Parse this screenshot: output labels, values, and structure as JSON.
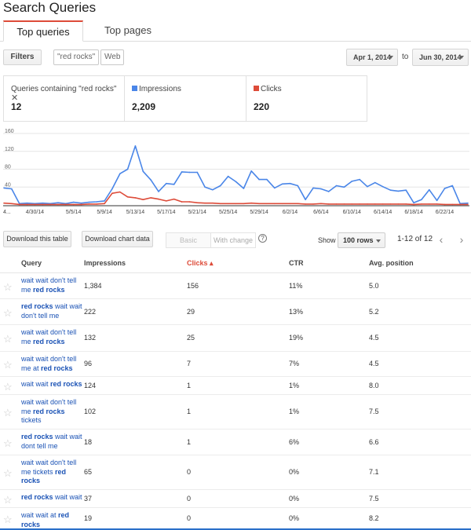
{
  "page": {
    "title": "Search Queries"
  },
  "tabs": [
    {
      "label": "Top queries",
      "active": true
    },
    {
      "label": "Top pages",
      "active": false
    }
  ],
  "filters": {
    "button_label": "Filters",
    "query_chip": "\"red rocks\"",
    "type_chip": "Web"
  },
  "date_range": {
    "start": "Apr 1, 2014",
    "separator": "to",
    "end": "Jun 30, 2014"
  },
  "metrics": {
    "queries": {
      "label": "Queries containing \"red rocks\"",
      "value": "12"
    },
    "impressions": {
      "label": "Impressions",
      "value": "2,209",
      "color": "#4a86e8"
    },
    "clicks": {
      "label": "Clicks",
      "value": "220",
      "color": "#dd4b39"
    }
  },
  "chart_data": {
    "type": "line",
    "x": [
      "4/26/14",
      "4/27/14",
      "4/28/14",
      "4/29/14",
      "4/30/14",
      "5/1/14",
      "5/2/14",
      "5/3/14",
      "5/4/14",
      "5/5/14",
      "5/6/14",
      "5/7/14",
      "5/8/14",
      "5/9/14",
      "5/10/14",
      "5/11/14",
      "5/12/14",
      "5/13/14",
      "5/14/14",
      "5/15/14",
      "5/16/14",
      "5/17/14",
      "5/18/14",
      "5/19/14",
      "5/20/14",
      "5/21/14",
      "5/22/14",
      "5/23/14",
      "5/24/14",
      "5/25/14",
      "5/26/14",
      "5/27/14",
      "5/28/14",
      "5/29/14",
      "5/30/14",
      "5/31/14",
      "6/1/14",
      "6/2/14",
      "6/3/14",
      "6/4/14",
      "6/5/14",
      "6/6/14",
      "6/7/14",
      "6/8/14",
      "6/9/14",
      "6/10/14",
      "6/11/14",
      "6/12/14",
      "6/13/14",
      "6/14/14",
      "6/15/14",
      "6/16/14",
      "6/17/14",
      "6/18/14",
      "6/19/14",
      "6/20/14",
      "6/21/14",
      "6/22/14",
      "6/23/14",
      "6/24/14",
      "6/25/14"
    ],
    "x_tick_labels": [
      "4...",
      "4/30/14",
      "5/5/14",
      "5/9/14",
      "5/13/14",
      "5/17/14",
      "5/21/14",
      "5/25/14",
      "5/29/14",
      "6/2/14",
      "6/6/14",
      "6/10/14",
      "6/14/14",
      "6/18/14",
      "6/22/14"
    ],
    "y_tick_labels": [
      "160",
      "120",
      "80",
      "40"
    ],
    "ylim": [
      0,
      160
    ],
    "series": [
      {
        "name": "Impressions",
        "color": "#4a86e8",
        "values": [
          38,
          36,
          3,
          4,
          3,
          4,
          3,
          5,
          3,
          6,
          4,
          6,
          7,
          9,
          36,
          70,
          80,
          132,
          75,
          56,
          30,
          48,
          46,
          74,
          73,
          73,
          40,
          34,
          43,
          64,
          52,
          37,
          76,
          57,
          57,
          38,
          47,
          48,
          43,
          12,
          38,
          36,
          30,
          43,
          40,
          53,
          57,
          41,
          50,
          41,
          33,
          31,
          33,
          5,
          12,
          34,
          10,
          37,
          43,
          3,
          4
        ]
      },
      {
        "name": "Clicks",
        "color": "#dd4b39",
        "values": [
          4,
          3,
          1,
          1,
          1,
          1,
          1,
          1,
          1,
          1,
          1,
          2,
          2,
          3,
          26,
          29,
          18,
          16,
          12,
          16,
          13,
          9,
          13,
          7,
          7,
          5,
          4,
          4,
          3,
          3,
          3,
          3,
          4,
          3,
          3,
          3,
          3,
          3,
          3,
          2,
          2,
          3,
          2,
          2,
          2,
          2,
          2,
          2,
          2,
          2,
          2,
          2,
          2,
          1,
          2,
          2,
          2,
          1,
          1,
          1,
          1
        ]
      }
    ]
  },
  "toolbar": {
    "download_table": "Download this table",
    "download_chart": "Download chart data",
    "basic": "Basic",
    "with_change": "With change",
    "help": "?",
    "show_label": "Show",
    "rows_select": "100 rows",
    "pagination": "1-12 of 12",
    "prev": "‹",
    "next": "›"
  },
  "table": {
    "headers": {
      "query": "Query",
      "impressions": "Impressions",
      "clicks": "Clicks ▴",
      "ctr": "CTR",
      "position": "Avg. position"
    },
    "rows": [
      {
        "q": [
          "wait wait don't tell",
          "me ",
          "red rocks",
          ""
        ],
        "impressions": "1,384",
        "clicks": "156",
        "ctr": "11%",
        "pos": "5.0"
      },
      {
        "q": [
          "",
          "",
          "red rocks",
          " wait wait don't tell me"
        ],
        "impressions": "222",
        "clicks": "29",
        "ctr": "13%",
        "pos": "5.2"
      },
      {
        "q": [
          "wait wait don't tell",
          "me ",
          "red rocks",
          ""
        ],
        "impressions": "132",
        "clicks": "25",
        "ctr": "19%",
        "pos": "4.5"
      },
      {
        "q": [
          "wait wait don't tell",
          "me at ",
          "red rocks",
          ""
        ],
        "impressions": "96",
        "clicks": "7",
        "ctr": "7%",
        "pos": "4.5"
      },
      {
        "q": [
          "wait wait ",
          "",
          "red rocks",
          ""
        ],
        "impressions": "124",
        "clicks": "1",
        "ctr": "1%",
        "pos": "8.0"
      },
      {
        "q": [
          "wait wait don't tell",
          "me ",
          "red rocks",
          " tickets"
        ],
        "impressions": "102",
        "clicks": "1",
        "ctr": "1%",
        "pos": "7.5"
      },
      {
        "q": [
          "",
          "",
          "red rocks",
          " wait wait dont tell me"
        ],
        "impressions": "18",
        "clicks": "1",
        "ctr": "6%",
        "pos": "6.6"
      },
      {
        "q": [
          "wait wait don't tell",
          "me tickets ",
          "red rocks",
          ""
        ],
        "impressions": "65",
        "clicks": "0",
        "ctr": "0%",
        "pos": "7.1"
      },
      {
        "q": [
          "",
          "",
          "red rocks",
          " wait wait"
        ],
        "impressions": "37",
        "clicks": "0",
        "ctr": "0%",
        "pos": "7.5"
      },
      {
        "q": [
          "wait wait at ",
          "",
          "red rocks",
          ""
        ],
        "impressions": "19",
        "clicks": "0",
        "ctr": "0%",
        "pos": "8.2"
      }
    ]
  }
}
